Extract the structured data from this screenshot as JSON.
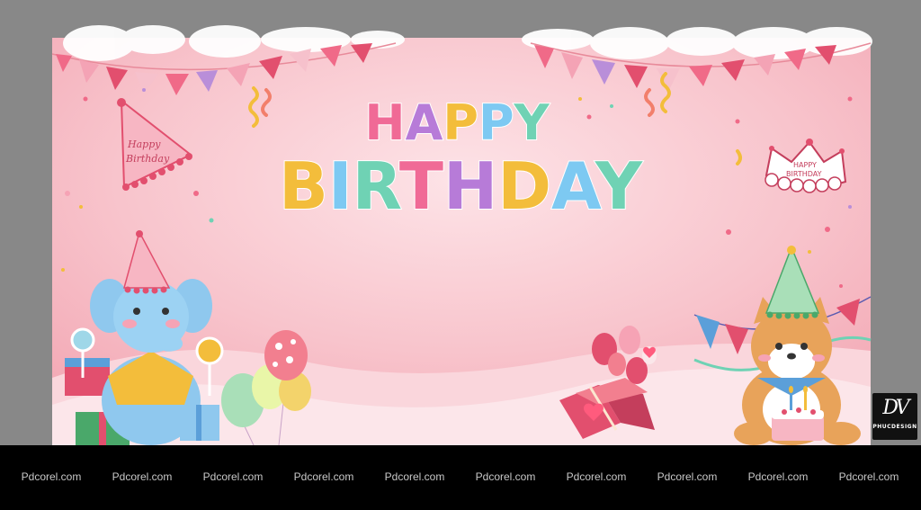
{
  "banner": {
    "title_top": "HAPPY",
    "title_bottom": "BIRTHDAY",
    "hat_text_1": "Happy",
    "hat_text_2": "Birthday",
    "crown_text_1": "HAPPY",
    "crown_text_2": "BIRTHDAY",
    "letter_colors": [
      "#f06a96",
      "#b77bd8",
      "#f3bd3b",
      "#7dc9f2",
      "#6fd2b4"
    ]
  },
  "brand": {
    "mark": "DV",
    "text": "PHUCDESIGN"
  },
  "footer": {
    "watermarks": [
      "Pdcorel.com",
      "Pdcorel.com",
      "Pdcorel.com",
      "Pdcorel.com",
      "Pdcorel.com",
      "Pdcorel.com",
      "Pdcorel.com",
      "Pdcorel.com",
      "Pdcorel.com",
      "Pdcorel.com"
    ]
  }
}
